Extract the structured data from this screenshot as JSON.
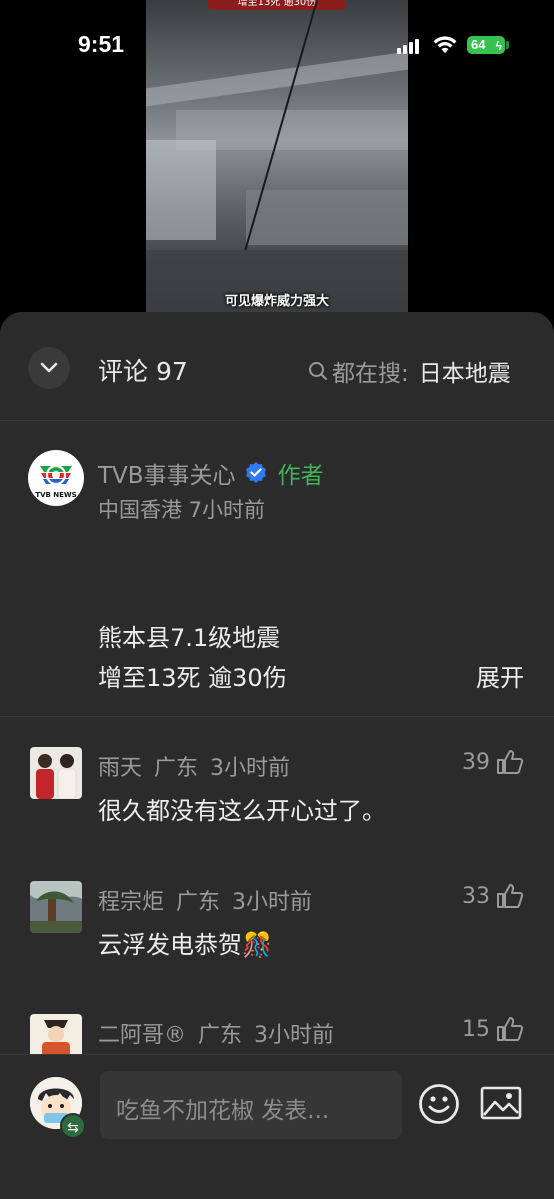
{
  "status_bar": {
    "time": "9:51",
    "battery": "64"
  },
  "video": {
    "top_caption": "增至13死 逾30伤",
    "subtitle": "可见爆炸威力强大"
  },
  "header": {
    "title": "评论 97",
    "search_prefix": "都在搜:",
    "search_term": "日本地震"
  },
  "author_post": {
    "name": "TVB事事关心",
    "badge": "作者",
    "location_time": "中国香港 7小时前",
    "line1": "熊本县7.1级地震",
    "line2": "增至13死 逾30伤",
    "expand_label": "展开",
    "logo_text": "TVB NEWS"
  },
  "comments": [
    {
      "user": "雨天",
      "region": "广东",
      "time": "3小时前",
      "likes": "39",
      "text": "很久都没有这么开心过了。"
    },
    {
      "user": "程宗炬",
      "region": "广东",
      "time": "3小时前",
      "likes": "33",
      "text": "云浮发电恭贺🎊"
    },
    {
      "user": "二阿哥®",
      "region": "广东",
      "time": "3小时前",
      "likes": "15",
      "text": ""
    }
  ],
  "input": {
    "placeholder": "吃鱼不加花椒 发表..."
  },
  "colors": {
    "sheet_bg": "#2b2b2b",
    "author_badge": "#43b35a",
    "verified": "#2f7bf5",
    "battery": "#36c24e"
  }
}
